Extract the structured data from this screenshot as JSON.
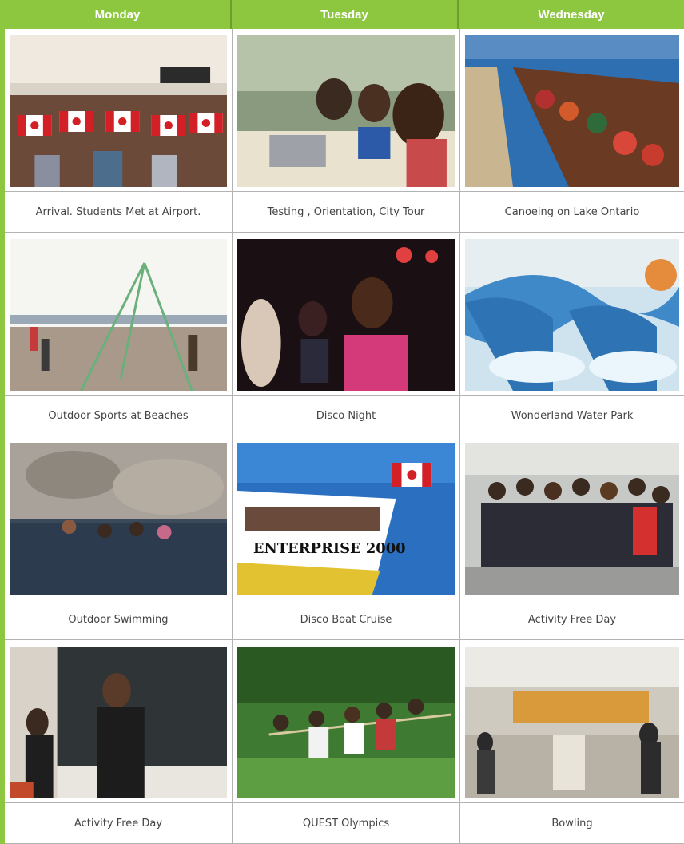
{
  "header": {
    "days": [
      "Monday",
      "Tuesday",
      "Wednesday"
    ]
  },
  "colors": {
    "accent": "#8dc63f",
    "grid_line": "#b3b3b3",
    "caption_text": "#444444"
  },
  "rows": [
    {
      "cells": [
        {
          "caption": "Arrival. Students Met at Airport.",
          "photo": "airport-group-with-canada-flags"
        },
        {
          "caption": "Testing , Orientation, City Tour",
          "photo": "students-at-laptops"
        },
        {
          "caption": "Canoeing on Lake Ontario",
          "photo": "students-in-canoe"
        }
      ]
    },
    {
      "cells": [
        {
          "caption": "Outdoor Sports at Beaches",
          "photo": "beach-volleyball"
        },
        {
          "caption": "Disco Night",
          "photo": "disco-dancing"
        },
        {
          "caption": "Wonderland Water Park",
          "photo": "water-slides"
        }
      ]
    },
    {
      "cells": [
        {
          "caption": "Outdoor Swimming",
          "photo": "swimming-in-lake"
        },
        {
          "caption": "Disco Boat Cruise",
          "photo": "cruise-boat",
          "photo_text": "ENTERPRISE 2000"
        },
        {
          "caption": "Activity Free Day",
          "photo": "group-waving"
        }
      ]
    },
    {
      "cells": [
        {
          "caption": "Activity Free Day",
          "photo": "classroom-students"
        },
        {
          "caption": "QUEST Olympics",
          "photo": "tug-of-war"
        },
        {
          "caption": "Bowling",
          "photo": "bowling-alley"
        }
      ]
    }
  ]
}
